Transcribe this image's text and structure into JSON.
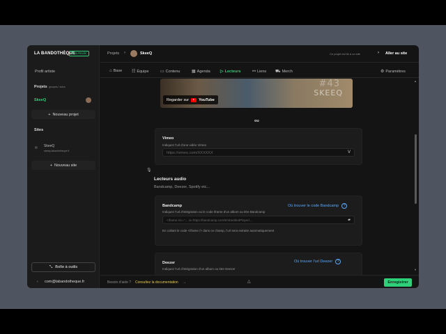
{
  "sidebar": {
    "brand": "LA BANDOTHÈQUE",
    "beta": "BÊTA PRIVÉE",
    "artist_profile": "Profil artiste",
    "projects_label": "Projets",
    "projects_sub": "groupes / solos",
    "active_project": "SkeeQ",
    "new_project": "Nouveau projet",
    "sites_label": "Sites",
    "site_name": "SkeeQ",
    "site_url": "skeeq.labandotheque.fr",
    "new_site": "Nouveau site",
    "toolbox": "Boîte à outils",
    "user_email": "com@labandotheque.fr"
  },
  "header": {
    "crumb_projects": "Projets",
    "project_name": "SkeeQ",
    "linked_text": "Ce projet est lié à un site",
    "goto_site": "Aller au site"
  },
  "tabs": [
    {
      "label": "Base",
      "icon": "home-icon"
    },
    {
      "label": "Équipe",
      "icon": "team-icon"
    },
    {
      "label": "Contenu",
      "icon": "document-icon"
    },
    {
      "label": "Agenda",
      "icon": "calendar-icon"
    },
    {
      "label": "Lecteurs",
      "icon": "play-icon"
    },
    {
      "label": "Liens",
      "icon": "link-icon"
    },
    {
      "label": "Merch",
      "icon": "shop-icon"
    },
    {
      "label": "Paramètres",
      "icon": "gear-icon"
    }
  ],
  "youtube": {
    "watch_on": "Regarder sur",
    "brand": "YouTube",
    "overlay_num": "#43",
    "overlay_name": "SKEEQ"
  },
  "or_label": "ou",
  "vimeo": {
    "title": "Vimeo",
    "desc": "Indiquez l'url d'une vidéo Vimeo",
    "placeholder": "https://vimeo.com/XXXXXX"
  },
  "audio": {
    "title": "Lecteurs audio",
    "subtitle": "Bandcamp, Deezer, Spotify etc..."
  },
  "bandcamp": {
    "title": "Bandcamp",
    "help": "Où trouver le code Bandcamp",
    "desc": "Indiquez l'url d'intégration ou le code iframe d'un album ou titre Bandcamp",
    "placeholder": "<iframe src=\"...    ou   https://bandcamp.com/EmbeddedPlayer/...",
    "note": "En collant le code <iframe /> dans ce champ, l'url sera extraite automatiquement"
  },
  "deezer": {
    "title": "Deezer",
    "help": "Où trouver l'url Deezer",
    "desc": "Indiquez l'url d'intégration d'un album ou titre Deezer"
  },
  "footer": {
    "need_help": "Besoin d'aide ?",
    "doc_link": "Consultez la documentation",
    "save": "Enregistrer"
  },
  "colors": {
    "accent": "#2fd07a",
    "link": "#5aa9ff",
    "doc": "#e6c94a"
  }
}
